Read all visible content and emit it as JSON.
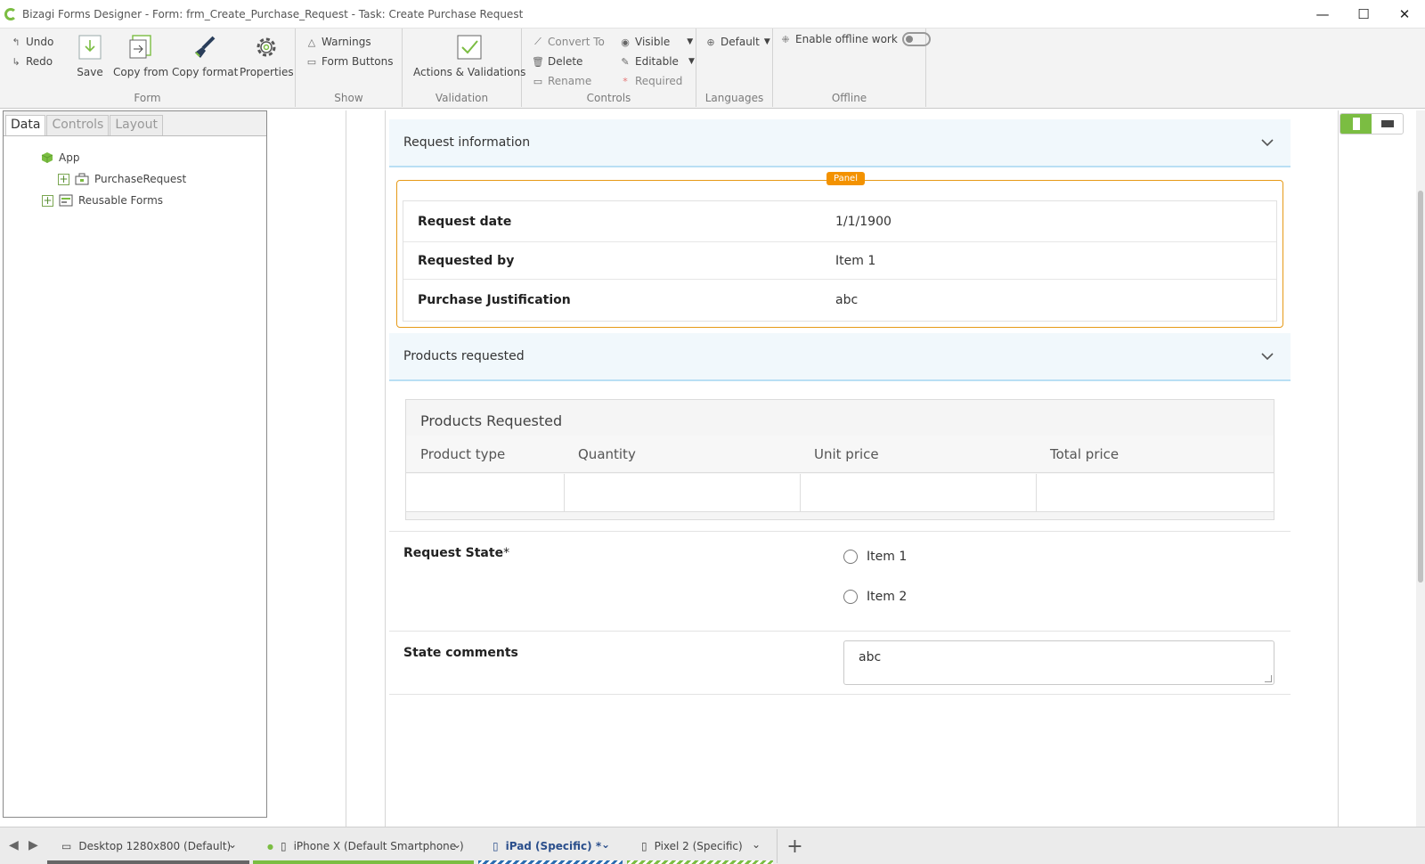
{
  "window": {
    "title": "Bizagi Forms Designer  - Form: frm_Create_Purchase_Request - Task:  Create Purchase Request",
    "minimize": "—",
    "maximize": "☐",
    "close": "✕"
  },
  "ribbon": {
    "form_group": {
      "label": "Form",
      "undo": "Undo",
      "redo": "Redo",
      "save": "Save",
      "copy_from": "Copy from",
      "copy_format": "Copy format",
      "properties": "Properties"
    },
    "show_group": {
      "label": "Show",
      "warnings": "Warnings",
      "form_buttons": "Form Buttons"
    },
    "validation_group": {
      "label": "Validation",
      "actions_validations": "Actions & Validations"
    },
    "controls_group": {
      "label": "Controls",
      "convert_to": "Convert To",
      "delete": "Delete",
      "rename": "Rename",
      "visible": "Visible",
      "editable": "Editable",
      "required": "Required"
    },
    "languages_group": {
      "label": "Languages",
      "default": "Default"
    },
    "offline_group": {
      "label": "Offline",
      "enable_offline": "Enable offline work"
    }
  },
  "left_panel": {
    "tabs": [
      "Data",
      "Controls",
      "Layout"
    ],
    "tree": {
      "root": "App",
      "child": "PurchaseRequest",
      "reusable": "Reusable Forms"
    }
  },
  "form": {
    "request_info": {
      "header": "Request information",
      "badge": "Panel",
      "fields": [
        {
          "label": "Request date",
          "value": "1/1/1900"
        },
        {
          "label": "Requested by",
          "value": "Item 1"
        },
        {
          "label": "Purchase Justification",
          "value": "abc"
        }
      ]
    },
    "products": {
      "header": "Products requested",
      "grid_title": "Products Requested",
      "columns": [
        "Product type",
        "Quantity",
        "Unit price",
        "Total price"
      ]
    },
    "request_state": {
      "label": "Request State",
      "required_mark": "*",
      "options": [
        "Item 1",
        "Item 2"
      ]
    },
    "state_comments": {
      "label": "State comments",
      "value": "abc"
    }
  },
  "device_tabs": [
    {
      "label": "Desktop 1280x800 (Default)",
      "color": "#666666"
    },
    {
      "label": "iPhone X (Default Smartphone )",
      "color": "#7bbd42"
    },
    {
      "label": "iPad (Specific) *",
      "color": "#2b6cb0"
    },
    {
      "label": "Pixel 2 (Specific)",
      "color": "#7bbd42"
    }
  ],
  "colors": {
    "accent": "#7bbd42",
    "panel_orange": "#f39200",
    "section_header_bg": "#f1f8fc"
  }
}
